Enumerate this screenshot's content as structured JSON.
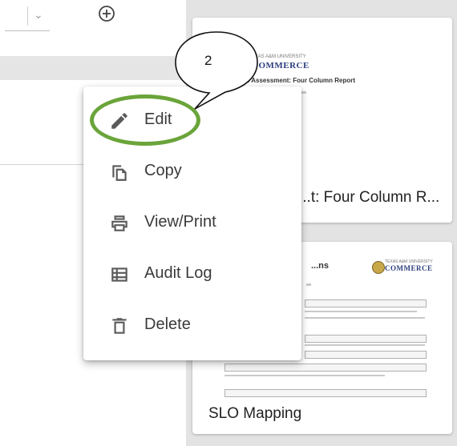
{
  "toolbar": {
    "add_icon": "plus-circle-icon",
    "chevron": "chevron-down-icon"
  },
  "cards": [
    {
      "title": "...t: Four Column R...",
      "thumb": {
        "logo": "COMMERCE",
        "heading": "...: Assessment: Four Column Report"
      }
    },
    {
      "title": "SLO Mapping",
      "thumb": {
        "logo": "COMMERCE",
        "heading": "...ns"
      }
    }
  ],
  "menu": {
    "items": [
      {
        "label": "Edit",
        "icon": "pencil-icon"
      },
      {
        "label": "Copy",
        "icon": "copy-icon"
      },
      {
        "label": "View/Print",
        "icon": "printer-icon"
      },
      {
        "label": "Audit Log",
        "icon": "list-icon"
      },
      {
        "label": "Delete",
        "icon": "trash-icon"
      }
    ]
  },
  "annotation": {
    "callout_number": "2",
    "highlight_color": "#6aa43a"
  },
  "colors": {
    "menu_text": "#3a3a3a",
    "background": "#e9e9e9"
  }
}
